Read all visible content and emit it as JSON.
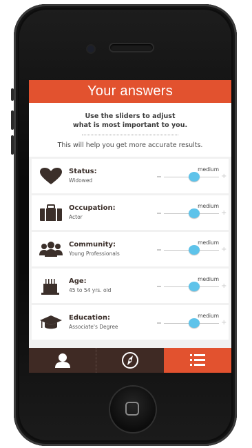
{
  "header": {
    "title": "Your answers"
  },
  "intro": {
    "line1": "Use the sliders to adjust",
    "line2": "what is most important to you.",
    "line3": "This will help you get more accurate results."
  },
  "rows": [
    {
      "label": "Status:",
      "value": "Widowed",
      "level_label": "medium",
      "level": 0.55,
      "icon": "heart-icon"
    },
    {
      "label": "Occupation:",
      "value": "Actor",
      "level_label": "medium",
      "level": 0.55,
      "icon": "briefcase-icon"
    },
    {
      "label": "Community:",
      "value": "Young Professionals",
      "level_label": "medium",
      "level": 0.55,
      "icon": "people-icon"
    },
    {
      "label": "Age:",
      "value": "45 to 54 yrs. old",
      "level_label": "medium",
      "level": 0.55,
      "icon": "birthday-cake-icon"
    },
    {
      "label": "Education:",
      "value": "Associate's Degree",
      "level_label": "medium",
      "level": 0.55,
      "icon": "graduation-cap-icon"
    }
  ],
  "tabs": [
    {
      "icon": "profile-icon",
      "active": false
    },
    {
      "icon": "compass-icon",
      "active": false
    },
    {
      "icon": "list-icon",
      "active": true
    }
  ],
  "colors": {
    "accent": "#e2522f",
    "slider_thumb": "#5ec3ea",
    "tabbar": "#3f2a24",
    "icon": "#3b2f2a"
  }
}
